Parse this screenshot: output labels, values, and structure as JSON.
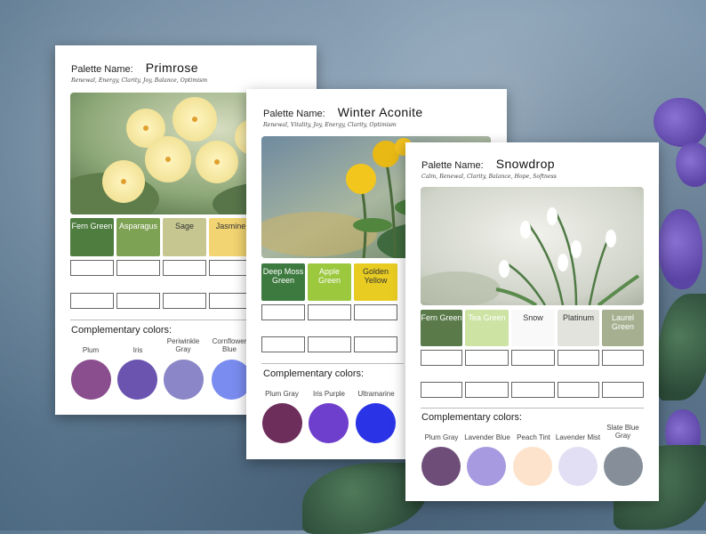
{
  "cards": [
    {
      "id": "primrose",
      "label": "Palette Name:",
      "name": "Primrose",
      "keywords": "Renewal, Energy, Clarity, Joy, Balance, Optimism",
      "swatches": [
        {
          "name": "Fern Green",
          "color": "#4f7d3f"
        },
        {
          "name": "Asparagus",
          "color": "#7ea254"
        },
        {
          "name": "Sage",
          "color": "#c5c690"
        },
        {
          "name": "Jasmine",
          "color": "#f2d472"
        }
      ],
      "comp_heading": "Complementary colors:",
      "complementary": [
        {
          "name": "Plum",
          "color": "#8a4e8e"
        },
        {
          "name": "Iris",
          "color": "#6a54b0"
        },
        {
          "name": "Periwinkle Gray",
          "color": "#8a86c8"
        },
        {
          "name": "Cornflower Blue",
          "color": "#7a8cf0"
        }
      ]
    },
    {
      "id": "winter-aconite",
      "label": "Palette Name:",
      "name": "Winter Aconite",
      "keywords": "Renewal, Vitality, Joy, Energy, Clarity, Optimism",
      "swatches": [
        {
          "name": "Deep Moss Green",
          "color": "#3d7a3f"
        },
        {
          "name": "Apple Green",
          "color": "#9cc83e"
        },
        {
          "name": "Golden Yellow",
          "color": "#e8cc22"
        }
      ],
      "comp_heading": "Complementary colors:",
      "complementary": [
        {
          "name": "Plum Gray",
          "color": "#6e2e5c"
        },
        {
          "name": "Iris Purple",
          "color": "#6e3ecc"
        },
        {
          "name": "Ultramarine",
          "color": "#2a34e6"
        }
      ]
    },
    {
      "id": "snowdrop",
      "label": "Palette Name:",
      "name": "Snowdrop",
      "keywords": "Calm, Renewal, Clarity, Balance, Hope, Softness",
      "swatches": [
        {
          "name": "Fern Green",
          "color": "#5a7a4a"
        },
        {
          "name": "Tea Green",
          "color": "#cde3a3"
        },
        {
          "name": "Snow",
          "color": "#f9f9f9"
        },
        {
          "name": "Platinum",
          "color": "#e3e3de"
        },
        {
          "name": "Laurel Green",
          "color": "#a6af8f"
        }
      ],
      "comp_heading": "Complementary colors:",
      "complementary": [
        {
          "name": "Plum Gray",
          "color": "#6e4e78"
        },
        {
          "name": "Lavender Blue",
          "color": "#a89ae0"
        },
        {
          "name": "Peach Tint",
          "color": "#fde3cc"
        },
        {
          "name": "Lavender Mist",
          "color": "#e2dff4"
        },
        {
          "name": "Slate Blue Gray",
          "color": "#868f99"
        }
      ]
    }
  ]
}
